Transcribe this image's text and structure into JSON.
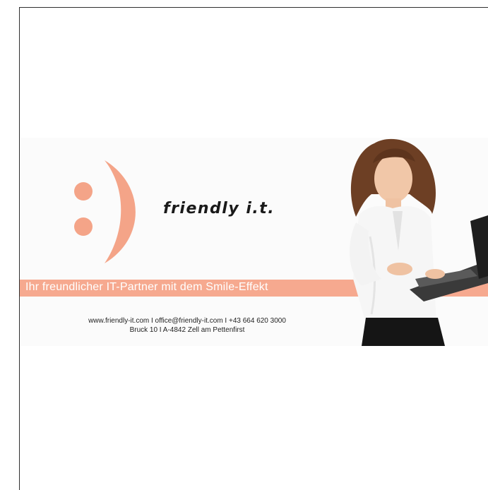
{
  "brand": {
    "logo_text": "friendly i.t.",
    "slogan": "Ihr freundlicher IT-Partner mit dem Smile-Effekt",
    "contact_line_1": "www.friendly-it.com I office@friendly-it.com I +43 664 620 3000",
    "contact_line_2": "Bruck 10 I A-4842 Zell am Pettenfirst"
  },
  "icons": {
    "logo": "smiley-face-icon",
    "photo": "woman-with-laptop-image"
  },
  "colors": {
    "accent": "#f6a98f",
    "smiley": "#f4a488",
    "text": "#1a1a1a",
    "frame": "#2f2f2f"
  }
}
